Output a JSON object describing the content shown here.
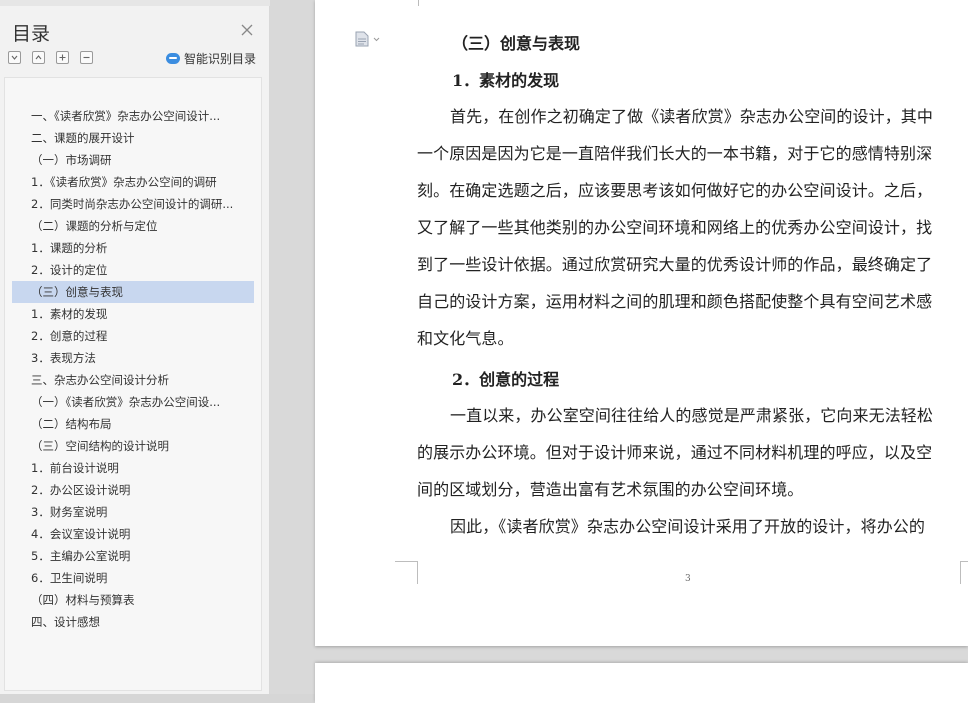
{
  "sidebar": {
    "title": "目录",
    "smart_label": "智能识别目录",
    "items": [
      {
        "label": "一、《读者欣赏》杂志办公空间设计..."
      },
      {
        "label": "二、课题的展开设计"
      },
      {
        "label": "（一）市场调研"
      },
      {
        "label": "1．《读者欣赏》杂志办公空间的调研"
      },
      {
        "label": "2．同类时尚杂志办公空间设计的调研..."
      },
      {
        "label": "（二）课题的分析与定位"
      },
      {
        "label": "1．课题的分析"
      },
      {
        "label": "2．设计的定位"
      },
      {
        "label": "（三）创意与表现"
      },
      {
        "label": "1．素材的发现"
      },
      {
        "label": "2．创意的过程"
      },
      {
        "label": "3．表现方法"
      },
      {
        "label": "三、杂志办公空间设计分析"
      },
      {
        "label": "（一）《读者欣赏》杂志办公空间设..."
      },
      {
        "label": "（二）结构布局"
      },
      {
        "label": "（三）空间结构的设计说明"
      },
      {
        "label": "1．前台设计说明"
      },
      {
        "label": "2．办公区设计说明"
      },
      {
        "label": "3．财务室说明"
      },
      {
        "label": "4．会议室设计说明"
      },
      {
        "label": "5．主编办公室说明"
      },
      {
        "label": "6．卫生间说明"
      },
      {
        "label": "（四）材料与预算表"
      },
      {
        "label": "四、设计感想"
      }
    ],
    "active_index": 8
  },
  "document": {
    "heading1": "（三）创意与表现",
    "heading2": "1．素材的发现",
    "lines1": [
      "首先，在创作之初确定了做《读者欣赏》杂志办公空间的设计，其中",
      "一个原因是因为它是一直陪伴我们长大的一本书籍，对于它的感情特别深",
      "刻。在确定选题之后，应该要思考该如何做好它的办公空间设计。之后，",
      "又了解了一些其他类别的办公空间环境和网络上的优秀办公空间设计，找",
      "到了一些设计依据。通过欣赏研究大量的优秀设计师的作品，最终确定了",
      "自己的设计方案，运用材料之间的肌理和颜色搭配使整个具有空间艺术感",
      "和文化气息。"
    ],
    "heading3": "2．创意的过程",
    "lines2": [
      "一直以来，办公室空间往往给人的感觉是严肃紧张，它向来无法轻松",
      "的展示办公环境。但对于设计师来说，通过不同材料机理的呼应，以及空",
      "间的区域划分，营造出富有艺术氛围的办公空间环境。",
      "因此，《读者欣赏》杂志办公空间设计采用了开放的设计，将办公的"
    ],
    "page_number": "3"
  },
  "icons": [
    "close-icon",
    "collapse-all-icon",
    "expand-all-icon",
    "add-level-icon",
    "remove-level-icon",
    "smart-recognize-icon",
    "document-icon"
  ],
  "colors": {
    "active_item": "#c8d7ef",
    "accent": "#3b8de0"
  }
}
